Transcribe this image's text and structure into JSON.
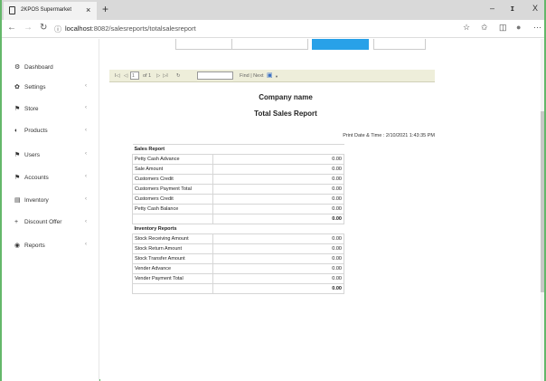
{
  "browser": {
    "tab_title": "2KPOS Supermarket",
    "url_host": "localhost",
    "url_path": ":8082/salesreports/totalsalesreport",
    "tab_close": "×",
    "new_tab": "+",
    "min": "–",
    "max": "☐",
    "close": "X",
    "more": "···"
  },
  "sidebar": {
    "items": [
      {
        "label": "Dashboard",
        "icon": "dashboard-icon",
        "glyph": "⚙",
        "chev": ""
      },
      {
        "label": "Settings",
        "icon": "settings-icon",
        "glyph": "✿",
        "chev": "‹"
      },
      {
        "label": "Store",
        "icon": "store-icon",
        "glyph": "⚑",
        "chev": "‹"
      },
      {
        "label": "Products",
        "icon": "products-icon",
        "glyph": "◐",
        "chev": "‹"
      },
      {
        "label": "Users",
        "icon": "users-icon",
        "glyph": "⚑",
        "chev": "‹"
      },
      {
        "label": "Accounts",
        "icon": "accounts-icon",
        "glyph": "⚑",
        "chev": "‹"
      },
      {
        "label": "Inventory",
        "icon": "inventory-icon",
        "glyph": "▤",
        "chev": "‹"
      },
      {
        "label": "Discount Offer",
        "icon": "discount-icon",
        "glyph": "+",
        "chev": "‹"
      },
      {
        "label": "Reports",
        "icon": "reports-icon",
        "glyph": "◉",
        "chev": "‹"
      }
    ]
  },
  "viewer": {
    "first": "I◁",
    "prev": "◁",
    "page": "1",
    "of_pages": "of 1",
    "next": "▷",
    "last": "▷I",
    "refresh": "↻",
    "find_next": "Find | Next",
    "save": "▼"
  },
  "report": {
    "company": "Company name",
    "title": "Total Sales Report",
    "print_date": "Print Date & Time : 2/10/2021 1:43:35 PM",
    "sales_header": "Sales Report",
    "sales_rows": [
      {
        "label": "Petty Cash Advance",
        "value": "0.00"
      },
      {
        "label": "Sale Amount",
        "value": "0.00"
      },
      {
        "label": "Customers Credit",
        "value": "0.00"
      },
      {
        "label": "Customers Payment Total",
        "value": "0.00"
      },
      {
        "label": "Customers Credit",
        "value": "0.00"
      },
      {
        "label": "Petty Cash Balance",
        "value": "0.00"
      }
    ],
    "sales_total": "0.00",
    "inventory_header": "Inventory Reports",
    "inventory_rows": [
      {
        "label": "Stock Receiving Amount",
        "value": "0.00"
      },
      {
        "label": "Stock Return Amount",
        "value": "0.00"
      },
      {
        "label": "Stock Transfer Amount",
        "value": "0.00"
      },
      {
        "label": "Vender Advance",
        "value": "0.00"
      },
      {
        "label": "Vender Payment Total",
        "value": "0.00"
      }
    ],
    "inventory_total": "0.00"
  }
}
